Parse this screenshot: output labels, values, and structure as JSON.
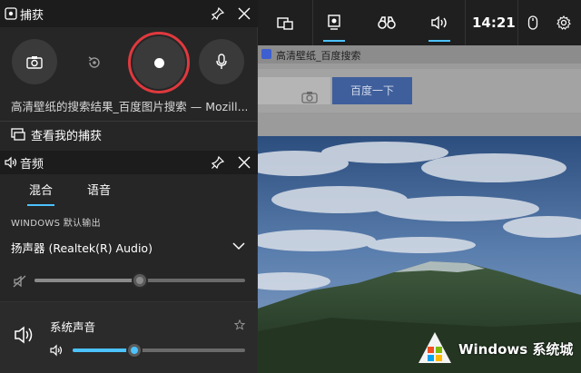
{
  "capture_panel": {
    "title": "捕获",
    "source_window": "高清壁纸的搜索结果_百度图片搜索 — Mozill...",
    "view_captures": "查看我的捕获"
  },
  "audio_panel": {
    "title": "音频",
    "tabs": [
      {
        "label": "混合",
        "active": true
      },
      {
        "label": "语音",
        "active": false
      }
    ],
    "section_label": "WINDOWS 默认输出",
    "output_device": "扬声器 (Realtek(R) Audio)",
    "master_volume_fraction": 0.5,
    "master_muted": true,
    "app_mixer": [
      {
        "label": "系统声音",
        "volume_fraction": 0.36
      }
    ]
  },
  "topbar": {
    "time": "14:21",
    "buttons": [
      {
        "icon": "widget-menu-icon",
        "active": false
      },
      {
        "icon": "capture-widget-icon",
        "active": true
      },
      {
        "icon": "performance-binoculars-icon",
        "active": false
      },
      {
        "icon": "audio-widget-icon",
        "active": true
      }
    ],
    "accent": "#4cc2ff"
  },
  "background_page": {
    "tab_title": "高清壁纸_百度搜索",
    "search_button": "百度一下"
  },
  "watermark": {
    "text": "Windows 系统城"
  },
  "colors": {
    "record_ring": "#e0393e",
    "panel_bg": "#262626",
    "header_bg": "#1c1c1c",
    "slider_accent": "#4cc2ff"
  }
}
